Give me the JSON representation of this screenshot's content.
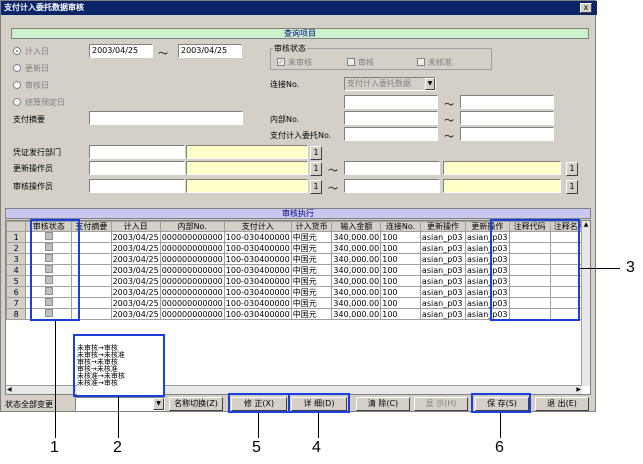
{
  "window": {
    "title": "支付计入委托数据审核",
    "close": "x"
  },
  "query_section": {
    "header": "查询项目"
  },
  "date_options": [
    {
      "label": "计入日",
      "selected": true
    },
    {
      "label": "更新日",
      "selected": false
    },
    {
      "label": "审核日",
      "selected": false
    },
    {
      "label": "结算预定日",
      "selected": false
    }
  ],
  "date_from": "2003/04/25",
  "date_sep": "～",
  "date_to": "2003/04/25",
  "review_status": {
    "label": "审核状态",
    "options": [
      "未审核",
      "审核",
      "未核准"
    ]
  },
  "fields": {
    "payment_summary": "支付摘要",
    "voucher_dept": "凭证发行部门",
    "update_operator": "更新操作员",
    "review_operator": "审核操作员",
    "link_no": "连接No.",
    "link_no_value": "支付计入委托数据",
    "internal_no": "内部No.",
    "payment_entrust_no": "支付计入委托No."
  },
  "tilde": "～",
  "lookup_button": "1",
  "exec_section": {
    "header": "审核执行"
  },
  "table": {
    "columns": [
      "审核状态",
      "支付摘要",
      "计入日",
      "内部No.",
      "支付计入",
      "计入货币",
      "输入金额",
      "连接No.",
      "更新操作",
      "更新操作",
      "注释代码",
      "注释名称"
    ],
    "rows": [
      [
        "1",
        "",
        "",
        "2003/04/25",
        "000000000000",
        "100-030400000",
        "中国元",
        "340,000.00",
        "100",
        "asian_p03",
        "asian_p03",
        "",
        ""
      ],
      [
        "2",
        "",
        "",
        "2003/04/25",
        "000000000000",
        "100-030400000",
        "中国元",
        "340,000.00",
        "100",
        "asian_p03",
        "asian_p03",
        "",
        ""
      ],
      [
        "3",
        "",
        "",
        "2003/04/25",
        "000000000000",
        "100-030400000",
        "中国元",
        "340,000.00",
        "100",
        "asian_p03",
        "asian_p03",
        "",
        ""
      ],
      [
        "4",
        "",
        "",
        "2003/04/25",
        "000000000000",
        "100-030400000",
        "中国元",
        "340,000.00",
        "100",
        "asian_p03",
        "asian_p03",
        "",
        ""
      ],
      [
        "5",
        "",
        "",
        "2003/04/25",
        "000000000000",
        "100-030400000",
        "中国元",
        "340,000.00",
        "100",
        "asian_p03",
        "asian_p03",
        "",
        ""
      ],
      [
        "6",
        "",
        "",
        "2003/04/25",
        "000000000000",
        "100-030400000",
        "中国元",
        "340,000.00",
        "100",
        "asian_p03",
        "asian_p03",
        "",
        ""
      ],
      [
        "7",
        "",
        "",
        "2003/04/25",
        "000000000000",
        "100-030400000",
        "中国元",
        "340,000.00",
        "100",
        "asian_p03",
        "asian_p03",
        "",
        ""
      ],
      [
        "8",
        "",
        "",
        "2003/04/25",
        "000000000000",
        "100-030400000",
        "中国元",
        "340,000.00",
        "100",
        "asian_p03",
        "asian_p03",
        "",
        ""
      ]
    ]
  },
  "status_popup": [
    "未审核→审核",
    "未审核→未核准",
    "审核→未审核",
    "审核→未核准",
    "未核准→未审核",
    "未核准→审核"
  ],
  "bottom": {
    "status_change_label": "状态全部变更",
    "name_switch": "名称切换(Z)",
    "modify": "修 正(X)",
    "detail": "详 细(D)",
    "clear": "清 除(C)",
    "show": "显 示(H)",
    "save": "保 存(S)",
    "exit": "退 出(E)"
  },
  "callouts": [
    "1",
    "2",
    "3",
    "4",
    "5",
    "6"
  ],
  "colors": {
    "callout": "#1a3fe0",
    "titlebar": "#0a246a",
    "query_band": "#ccf2cc",
    "exec_band": "#c8c8f0",
    "highlight_field": "#ffffc8"
  }
}
